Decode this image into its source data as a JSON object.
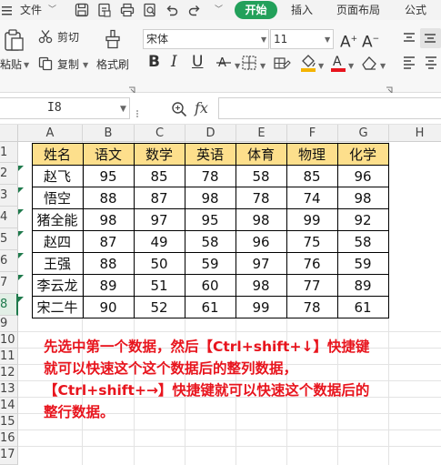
{
  "menu": {
    "file_label": "文件",
    "tabs": [
      "开始",
      "插入",
      "页面布局",
      "公式"
    ]
  },
  "ribbon": {
    "paste_label": "粘贴",
    "cut_label": "剪切",
    "copy_label": "复制",
    "format_painter_label": "格式刷",
    "font_name": "宋体",
    "font_size": "11",
    "format_buttons": [
      "B",
      "I",
      "U"
    ]
  },
  "formula_bar": {
    "name_box": "I8",
    "fx_label": "fx"
  },
  "sheet": {
    "columns": [
      "A",
      "B",
      "C",
      "D",
      "E",
      "F",
      "G",
      "H"
    ],
    "rows": [
      "1",
      "2",
      "3",
      "4",
      "5",
      "6",
      "7",
      "8",
      "9",
      "10",
      "11",
      "12",
      "13",
      "14",
      "15",
      "16",
      "17"
    ],
    "headers": [
      "姓名",
      "语文",
      "数学",
      "英语",
      "体育",
      "物理",
      "化学"
    ],
    "data": [
      [
        "赵飞",
        "95",
        "85",
        "78",
        "58",
        "85",
        "96"
      ],
      [
        "悟空",
        "88",
        "87",
        "98",
        "78",
        "74",
        "98"
      ],
      [
        "猪全能",
        "98",
        "97",
        "95",
        "98",
        "99",
        "92"
      ],
      [
        "赵四",
        "87",
        "49",
        "58",
        "96",
        "75",
        "58"
      ],
      [
        "王强",
        "88",
        "50",
        "59",
        "97",
        "76",
        "59"
      ],
      [
        "李云龙",
        "89",
        "51",
        "60",
        "98",
        "77",
        "89"
      ],
      [
        "宋二牛",
        "90",
        "52",
        "61",
        "99",
        "78",
        "61"
      ]
    ]
  },
  "annotation": {
    "line1": "先选中第一个数据，然后【Ctrl+shift+↓】快捷键",
    "line2": "就可以快速这个这个数据后的整列数据，",
    "line3": "【Ctrl+shift+→】快捷键就可以快速这个数据后的",
    "line4": "整行数据。"
  },
  "colors": {
    "accent": "#22a05a",
    "header_fill": "#fddf8c",
    "annotation": "#e8141d"
  }
}
